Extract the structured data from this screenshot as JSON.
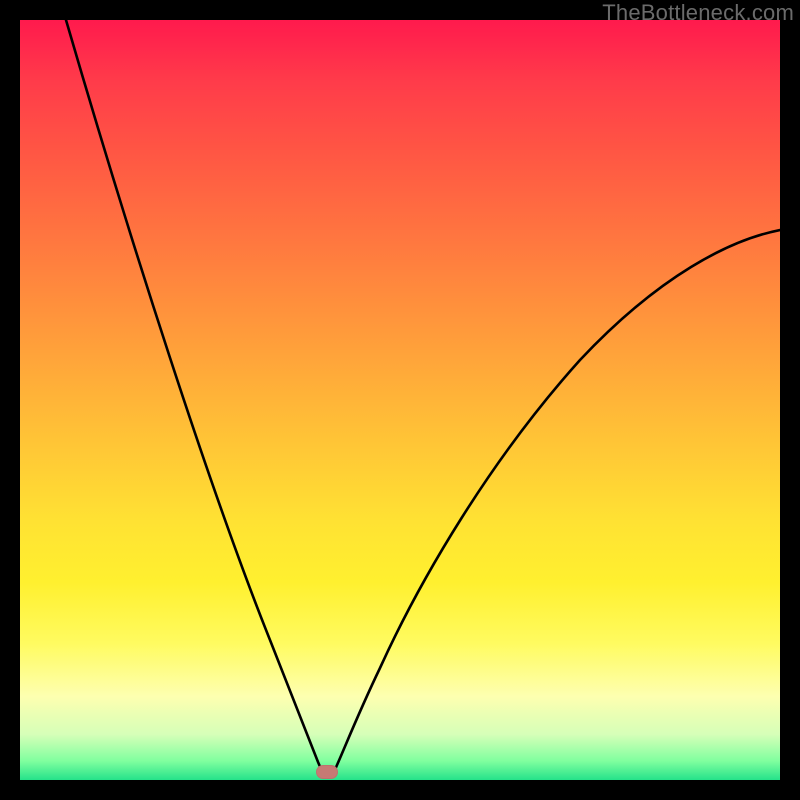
{
  "watermark": "TheBottleneck.com",
  "marker": {
    "x_frac": 0.405,
    "y_frac": 0.988
  },
  "chart_data": {
    "type": "line",
    "title": "",
    "xlabel": "",
    "ylabel": "",
    "xlim": [
      0,
      1
    ],
    "ylim": [
      0,
      1
    ],
    "background": "vertical-gradient red→orange→yellow→green (bottleneck heat)",
    "series": [
      {
        "name": "bottleneck-curve",
        "x": [
          0.06,
          0.1,
          0.14,
          0.18,
          0.22,
          0.26,
          0.3,
          0.33,
          0.36,
          0.385,
          0.4,
          0.41,
          0.44,
          0.48,
          0.55,
          0.62,
          0.7,
          0.8,
          0.9,
          1.0
        ],
        "y": [
          1.0,
          0.86,
          0.72,
          0.58,
          0.45,
          0.33,
          0.22,
          0.14,
          0.07,
          0.02,
          0.0,
          0.0,
          0.02,
          0.07,
          0.18,
          0.3,
          0.42,
          0.55,
          0.65,
          0.72
        ],
        "note": "y is fraction of plot height from bottom (0 = bottom edge = min bottleneck). Values estimated from pixels."
      }
    ],
    "annotations": [
      {
        "type": "marker",
        "shape": "pill",
        "color": "#c77a74",
        "x": 0.405,
        "y": 0.012,
        "meaning": "optimal / current configuration point"
      }
    ]
  }
}
